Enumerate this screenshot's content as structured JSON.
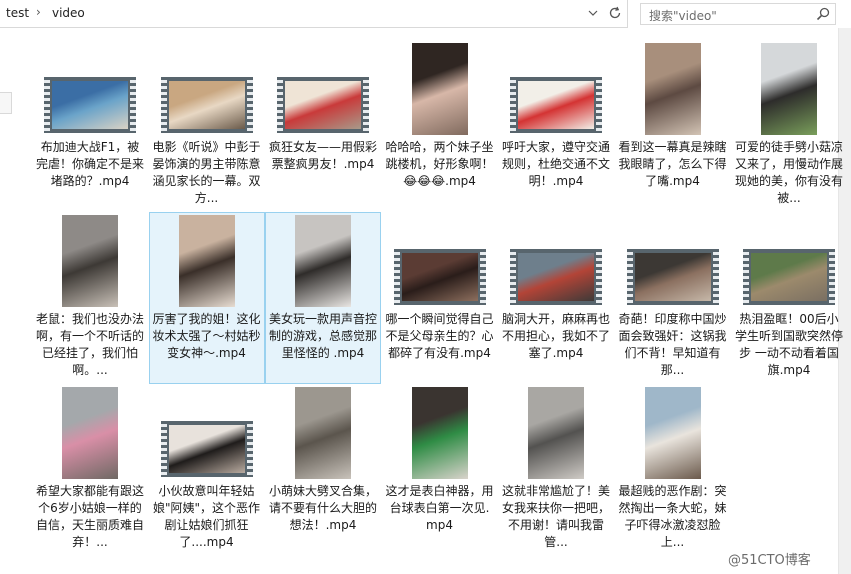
{
  "address": {
    "crumbs": [
      "test",
      "video"
    ],
    "separator": "›",
    "dropdown_icon": "chevron-down-icon",
    "refresh_icon": "refresh-icon"
  },
  "search": {
    "placeholder": "搜索\"video\""
  },
  "watermark": "@51CTO博客",
  "files": [
    {
      "label": "布加迪大战F1，被完虐！你确定不是来堵路的？.mp4",
      "thumb": "film",
      "tone": [
        "#3b6ea5",
        "#6aa3c9",
        "#d9d2c5"
      ]
    },
    {
      "label": "电影《听说》中彭于晏饰演的男主带陈意涵见家长的一幕。双方...",
      "thumb": "film",
      "tone": [
        "#c9a781",
        "#e8d8c4",
        "#6a5a4a"
      ]
    },
    {
      "label": "疯狂女友——用假彩票整疯男友！.mp4",
      "thumb": "film",
      "tone": [
        "#efe4d6",
        "#c93a3a",
        "#a89a8a"
      ]
    },
    {
      "label": "哈哈哈，两个妹子坐跳楼机，好形象啊！😂😂😂.mp4",
      "thumb": "plain",
      "tone": [
        "#2f2622",
        "#d7b7a8",
        "#806a5e"
      ]
    },
    {
      "label": "呼吁大家，遵守交通规则，杜绝交通不文明！.mp4",
      "thumb": "film",
      "tone": [
        "#f2efe8",
        "#d43333",
        "#f2efe8"
      ]
    },
    {
      "label": "看到这一幕真是辣瞎我眼睛了，怎么下得了嘴.mp4",
      "thumb": "plain",
      "tone": [
        "#a88f7c",
        "#5d4a42",
        "#d3c4b5"
      ]
    },
    {
      "label": "可爱的徒手劈小菇凉又来了，用慢动作展现她的美，你有没有被...",
      "thumb": "plain",
      "tone": [
        "#d5d8da",
        "#2d2c2b",
        "#7a9f5b"
      ]
    },
    {
      "label": "老鼠：我们也没办法啊，有一个不听话的已经挂了，我们怕啊。...",
      "thumb": "plain",
      "tone": [
        "#8e8a87",
        "#3d3935",
        "#c9c1b8"
      ]
    },
    {
      "label": "厉害了我的姐！这化妆术太强了～村姑秒变女神～.mp4",
      "thumb": "plain",
      "tone": [
        "#c9b29f",
        "#3a2f29",
        "#e8ddd2"
      ],
      "selected": true
    },
    {
      "label": "美女玩一款用声音控制的游戏，总感觉那里怪怪的 .mp4",
      "thumb": "plain",
      "tone": [
        "#c7c4c1",
        "#2f2c2a",
        "#e9e6e3"
      ],
      "selected": true
    },
    {
      "label": "哪一个瞬间觉得自己不是父母亲生的？心都碎了有没有.mp4",
      "thumb": "film",
      "tone": [
        "#5b3c34",
        "#2a1d1a",
        "#8d6f5e"
      ]
    },
    {
      "label": "脑洞大开，麻麻再也不用担心，我如不了塞了.mp4",
      "thumb": "film",
      "tone": [
        "#6e7f8c",
        "#b34437",
        "#3e3a38"
      ]
    },
    {
      "label": "奇葩！印度称中国炒面会致强奸：这锅我们不背！早知道有那...",
      "thumb": "film",
      "tone": [
        "#3c3834",
        "#8b7060",
        "#c6b8a9"
      ]
    },
    {
      "label": "热泪盈眶！00后小学生听到国歌突然停步 一动不动看着国旗.mp4",
      "thumb": "film",
      "tone": [
        "#5e7a4a",
        "#9c8a6c",
        "#7a6f62"
      ]
    },
    {
      "label": "希望大家都能有跟这个6岁小姑娘一样的自信，天生丽质难自弃！...",
      "thumb": "plain",
      "tone": [
        "#a4a8ab",
        "#d98fa7",
        "#6f6964"
      ]
    },
    {
      "label": "小伙故意叫年轻姑娘\"阿姨\"，这个恶作剧让姑娘们抓狂了....mp4",
      "thumb": "film",
      "tone": [
        "#e8e2dc",
        "#1f1c1b",
        "#b9aba0"
      ]
    },
    {
      "label": "小萌妹大劈叉合集，请不要有什么大胆的想法！.mp4",
      "thumb": "plain",
      "tone": [
        "#9c978f",
        "#5b554d",
        "#c9c3bb"
      ]
    },
    {
      "label": "这才是表白神器，用台球表白第一次见.mp4",
      "thumb": "plain",
      "tone": [
        "#3a3430",
        "#2f8c45",
        "#d9d3cc"
      ]
    },
    {
      "label": "这就非常尴尬了！美女我来扶你一把吧，不用谢！请叫我雷管...",
      "thumb": "plain",
      "tone": [
        "#a9a7a3",
        "#535250",
        "#cfcbc6"
      ]
    },
    {
      "label": "最超贱的恶作剧：突然掏出一条大蛇，妹子吓得冰激凌怼脸上...",
      "thumb": "plain",
      "tone": [
        "#9fb7c9",
        "#e9e4dd",
        "#6b5a4c"
      ]
    }
  ]
}
